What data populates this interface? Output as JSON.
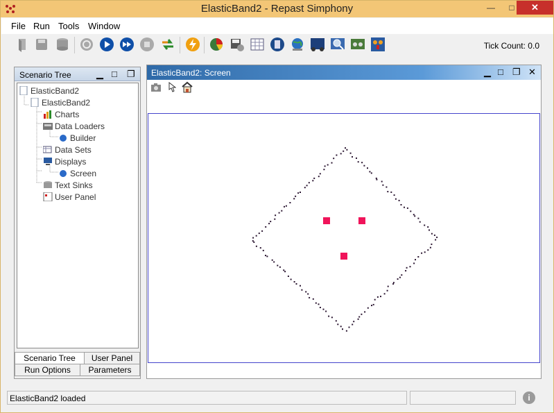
{
  "window": {
    "title": "ElasticBand2 - Repast Simphony",
    "icon": "repast-logo-icon"
  },
  "menu": [
    "File",
    "Run",
    "Tools",
    "Window"
  ],
  "toolbar": {
    "tick_label": "Tick Count: 0.0",
    "buttons": [
      "load-model-icon",
      "save-icon",
      "database-icon",
      "init-icon",
      "start-run-icon",
      "step-icon",
      "stop-icon",
      "reset-icon",
      "batch-icon",
      "spreadsheet-icon",
      "snapshot-settings-icon",
      "table-icon",
      "calculator-icon",
      "globe-icon",
      "network-icon",
      "search-icon",
      "graph-icon",
      "users-icon"
    ]
  },
  "tree_panel": {
    "title": "Scenario Tree",
    "nodes": {
      "root": "ElasticBand2",
      "model": "ElasticBand2",
      "charts": "Charts",
      "data_loaders": "Data Loaders",
      "builder": "Builder",
      "data_sets": "Data Sets",
      "displays": "Displays",
      "screen": "Screen",
      "text_sinks": "Text Sinks",
      "user_panel": "User Panel"
    },
    "tabs": {
      "scenario_tree": "Scenario Tree",
      "user_panel": "User Panel",
      "run_options": "Run Options",
      "parameters": "Parameters"
    }
  },
  "screen_panel": {
    "title": "ElasticBand2: Screen",
    "tools": [
      "camera-icon",
      "pointer-icon",
      "home-icon"
    ],
    "colors": {
      "band": "#2a1530",
      "agent": "#f0145a",
      "frame": "#4444cc"
    }
  },
  "status": {
    "message": "ElasticBand2 loaded"
  }
}
